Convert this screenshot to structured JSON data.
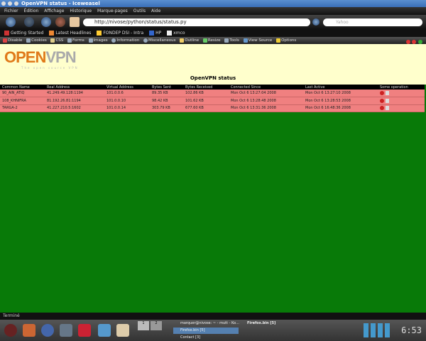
{
  "window": {
    "title": "OpenVPN status - Iceweasel"
  },
  "menu": [
    "Fichier",
    "Édition",
    "Affichage",
    "Historique",
    "Marque-pages",
    "Outils",
    "Aide"
  ],
  "nav": {
    "url": "http://nivose/python/status/status.py",
    "search_placeholder": "Yahoo"
  },
  "bookmarks": [
    "Getting Started",
    "Latest Headlines",
    "FONDEP DSI - Intra",
    "HP",
    "xmco"
  ],
  "webdev": [
    "Disable",
    "Cookies",
    "CSS",
    "Forms",
    "Images",
    "Information",
    "Miscellaneous",
    "Outline",
    "Resize",
    "Tools",
    "View Source",
    "Options"
  ],
  "page": {
    "logo": "OPENVPN",
    "tagline": "The open source VPN",
    "title": "OpenVPN status",
    "columns": [
      "Common Name",
      "Real Address",
      "Virtual Address",
      "Bytes Sent",
      "Bytes Received",
      "Connected Since",
      "Last Active",
      "Some operation"
    ],
    "rows": [
      [
        "90_AIN_ATIQ",
        "41.249.49.128:1194",
        "101.0.0.6",
        "89.35 KB",
        "102.86 KB",
        "Mon Oct 6 13:27:04 2008",
        "Mon Oct 6 13:27:10 2008"
      ],
      [
        "108_KHNIFRA",
        "81.192.26.81:1194",
        "101.0.0.10",
        "98.42 KB",
        "101.62 KB",
        "Mon Oct 6 13:28:48 2008",
        "Mon Oct 6 13:28:53 2008"
      ],
      [
        "TARGA-2",
        "41.227.210.5:1602",
        "101.0.0.14",
        "303.79 KB",
        "677.60 KB",
        "Mon Oct 6 13:31:36 2008",
        "Mon Oct 6 16:48:36 2008"
      ]
    ]
  },
  "status": "Terminé",
  "taskbar": {
    "tasks": [
      "marquer@nivose: ~ - mutt - Ko...",
      "Firefox.bin [5]",
      "Firefox.bin [5]",
      "Contact [3]"
    ],
    "desktops": [
      "1",
      "2"
    ],
    "clock": "6:53"
  }
}
